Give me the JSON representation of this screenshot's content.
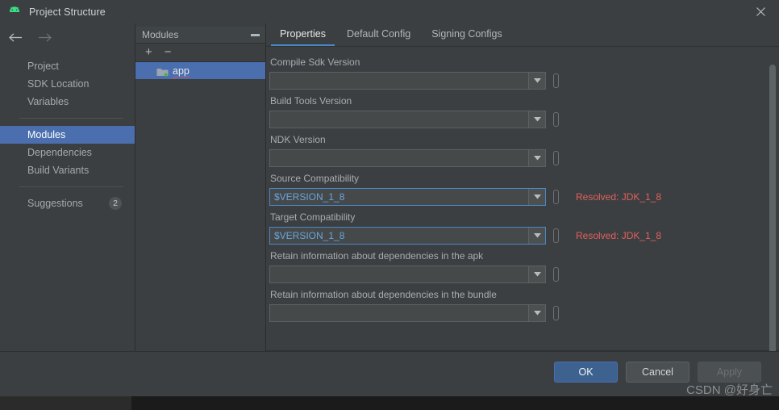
{
  "window": {
    "title": "Project Structure",
    "icon": "android-icon",
    "close_label": "×"
  },
  "nav": {
    "back_icon": "arrow-left-icon",
    "forward_icon": "arrow-right-icon",
    "items": [
      {
        "label": "Project",
        "selected": false
      },
      {
        "label": "SDK Location",
        "selected": false
      },
      {
        "label": "Variables",
        "selected": false
      },
      {
        "label": "Modules",
        "selected": true
      },
      {
        "label": "Dependencies",
        "selected": false
      },
      {
        "label": "Build Variants",
        "selected": false
      },
      {
        "label": "Suggestions",
        "selected": false,
        "badge": "2"
      }
    ]
  },
  "modules_panel": {
    "title": "Modules",
    "minimize_icon": "minimize-icon",
    "add_label": "+",
    "remove_label": "−",
    "items": [
      {
        "name": "app",
        "selected": true,
        "icon": "module-folder-icon"
      }
    ]
  },
  "properties": {
    "tabs": [
      {
        "label": "Properties",
        "active": true
      },
      {
        "label": "Default Config",
        "active": false
      },
      {
        "label": "Signing Configs",
        "active": false
      }
    ],
    "fields": [
      {
        "label": "Compile Sdk Version",
        "value": "",
        "accent": false,
        "resolved": ""
      },
      {
        "label": "Build Tools Version",
        "value": "",
        "accent": false,
        "resolved": ""
      },
      {
        "label": "NDK Version",
        "value": "",
        "accent": false,
        "resolved": ""
      },
      {
        "label": "Source Compatibility",
        "value": "$VERSION_1_8",
        "accent": true,
        "resolved": "Resolved: JDK_1_8"
      },
      {
        "label": "Target Compatibility",
        "value": "$VERSION_1_8",
        "accent": true,
        "resolved": "Resolved: JDK_1_8"
      },
      {
        "label": "Retain information about dependencies in the apk",
        "value": "",
        "accent": false,
        "resolved": ""
      },
      {
        "label": "Retain information about dependencies in the bundle",
        "value": "",
        "accent": false,
        "resolved": ""
      }
    ]
  },
  "footer": {
    "ok_label": "OK",
    "cancel_label": "Cancel",
    "apply_label": "Apply",
    "watermark": "CSDN @好身亡"
  },
  "colors": {
    "accent_blue": "#4b6eaf",
    "tab_underline": "#4a88c7",
    "resolved_red": "#e0605e",
    "value_blue": "#6ba4dd",
    "android_green": "#3ddc84",
    "window_bg": "#3c3f41"
  }
}
